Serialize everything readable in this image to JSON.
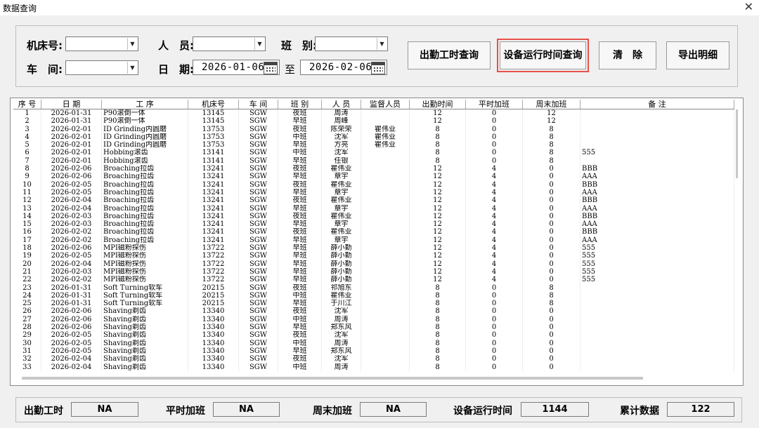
{
  "window": {
    "title": "数据查询",
    "close": "✕"
  },
  "filters": {
    "machine_label": "机床号:",
    "staff_label": "人　员:",
    "shift_label": "班　别:",
    "workshop_label": "车　间:",
    "date_label": "日　期:",
    "to_label": "至",
    "date_from": "2026-01-06",
    "date_to": "2026-02-06"
  },
  "buttons": {
    "attendance_query": "出勤工时查询",
    "runtime_query": "设备运行时间查询",
    "clear": "清　除",
    "export": "导出明细"
  },
  "table": {
    "columns": [
      "序 号",
      "日 期",
      "工 序",
      "机床号",
      "车 间",
      "班 别",
      "人 员",
      "监督人员",
      "出勤时间",
      "平时加班",
      "周末加班",
      "备 注"
    ],
    "rows": [
      [
        "1",
        "2026-01-31",
        "P90滚倒一体",
        "13145",
        "SGW",
        "夜班",
        "周涛",
        "",
        "12",
        "0",
        "12",
        ""
      ],
      [
        "2",
        "2026-01-31",
        "P90滚倒一体",
        "13145",
        "SGW",
        "早班",
        "周峰",
        "",
        "12",
        "0",
        "12",
        ""
      ],
      [
        "3",
        "2026-02-01",
        "ID Grinding内圆磨",
        "13753",
        "SGW",
        "夜班",
        "陈荣荣",
        "瞿伟业",
        "8",
        "0",
        "8",
        ""
      ],
      [
        "4",
        "2026-02-01",
        "ID Grinding内圆磨",
        "13753",
        "SGW",
        "中班",
        "沈军",
        "瞿伟业",
        "8",
        "0",
        "8",
        ""
      ],
      [
        "5",
        "2026-02-01",
        "ID Grinding内圆磨",
        "13753",
        "SGW",
        "早班",
        "方亮",
        "瞿伟业",
        "8",
        "0",
        "8",
        ""
      ],
      [
        "6",
        "2026-02-01",
        "Hobbing滚齿",
        "13141",
        "SGW",
        "中班",
        "沈军",
        "",
        "8",
        "0",
        "8",
        "555"
      ],
      [
        "7",
        "2026-02-01",
        "Hobbing滚齿",
        "13141",
        "SGW",
        "早班",
        "任银",
        "",
        "8",
        "0",
        "8",
        ""
      ],
      [
        "8",
        "2026-02-06",
        "Broaching拉齿",
        "13241",
        "SGW",
        "夜班",
        "瞿伟业",
        "",
        "12",
        "4",
        "0",
        "BBB"
      ],
      [
        "9",
        "2026-02-06",
        "Broaching拉齿",
        "13241",
        "SGW",
        "早班",
        "章宇",
        "",
        "12",
        "4",
        "0",
        "AAA"
      ],
      [
        "10",
        "2026-02-05",
        "Broaching拉齿",
        "13241",
        "SGW",
        "夜班",
        "瞿伟业",
        "",
        "12",
        "4",
        "0",
        "BBB"
      ],
      [
        "11",
        "2026-02-05",
        "Broaching拉齿",
        "13241",
        "SGW",
        "早班",
        "章宇",
        "",
        "12",
        "4",
        "0",
        "AAA"
      ],
      [
        "12",
        "2026-02-04",
        "Broaching拉齿",
        "13241",
        "SGW",
        "夜班",
        "瞿伟业",
        "",
        "12",
        "4",
        "0",
        "BBB"
      ],
      [
        "13",
        "2026-02-04",
        "Broaching拉齿",
        "13241",
        "SGW",
        "早班",
        "章宇",
        "",
        "12",
        "4",
        "0",
        "AAA"
      ],
      [
        "14",
        "2026-02-03",
        "Broaching拉齿",
        "13241",
        "SGW",
        "夜班",
        "瞿伟业",
        "",
        "12",
        "4",
        "0",
        "BBB"
      ],
      [
        "15",
        "2026-02-03",
        "Broaching拉齿",
        "13241",
        "SGW",
        "早班",
        "章宇",
        "",
        "12",
        "4",
        "0",
        "AAA"
      ],
      [
        "16",
        "2026-02-02",
        "Broaching拉齿",
        "13241",
        "SGW",
        "夜班",
        "瞿伟业",
        "",
        "12",
        "4",
        "0",
        "BBB"
      ],
      [
        "17",
        "2026-02-02",
        "Broaching拉齿",
        "13241",
        "SGW",
        "早班",
        "章宇",
        "",
        "12",
        "4",
        "0",
        "AAA"
      ],
      [
        "18",
        "2026-02-06",
        "MPI磁粉探伤",
        "13722",
        "SGW",
        "早班",
        "薛小勤",
        "",
        "12",
        "4",
        "0",
        "555"
      ],
      [
        "19",
        "2026-02-05",
        "MPI磁粉探伤",
        "13722",
        "SGW",
        "早班",
        "薛小勤",
        "",
        "12",
        "4",
        "0",
        "555"
      ],
      [
        "20",
        "2026-02-04",
        "MPI磁粉探伤",
        "13722",
        "SGW",
        "早班",
        "薛小勤",
        "",
        "12",
        "4",
        "0",
        "555"
      ],
      [
        "21",
        "2026-02-03",
        "MPI磁粉探伤",
        "13722",
        "SGW",
        "早班",
        "薛小勤",
        "",
        "12",
        "4",
        "0",
        "555"
      ],
      [
        "22",
        "2026-02-02",
        "MPI磁粉探伤",
        "13722",
        "SGW",
        "早班",
        "薛小勤",
        "",
        "12",
        "4",
        "0",
        "555"
      ],
      [
        "23",
        "2026-01-31",
        "Soft Turning软车",
        "20215",
        "SGW",
        "夜班",
        "祁旭东",
        "",
        "8",
        "0",
        "8",
        ""
      ],
      [
        "24",
        "2026-01-31",
        "Soft Turning软车",
        "20215",
        "SGW",
        "中班",
        "瞿伟业",
        "",
        "8",
        "0",
        "8",
        ""
      ],
      [
        "25",
        "2026-01-31",
        "Soft Turning软车",
        "20215",
        "SGW",
        "早班",
        "于川江",
        "",
        "8",
        "0",
        "8",
        ""
      ],
      [
        "26",
        "2026-02-06",
        "Shaving剃齿",
        "13340",
        "SGW",
        "夜班",
        "沈军",
        "",
        "8",
        "0",
        "0",
        ""
      ],
      [
        "27",
        "2026-02-06",
        "Shaving剃齿",
        "13340",
        "SGW",
        "中班",
        "周涛",
        "",
        "8",
        "0",
        "0",
        ""
      ],
      [
        "28",
        "2026-02-06",
        "Shaving剃齿",
        "13340",
        "SGW",
        "早班",
        "郑东风",
        "",
        "8",
        "0",
        "0",
        ""
      ],
      [
        "29",
        "2026-02-05",
        "Shaving剃齿",
        "13340",
        "SGW",
        "夜班",
        "沈军",
        "",
        "8",
        "0",
        "0",
        ""
      ],
      [
        "30",
        "2026-02-05",
        "Shaving剃齿",
        "13340",
        "SGW",
        "中班",
        "周涛",
        "",
        "8",
        "0",
        "0",
        ""
      ],
      [
        "31",
        "2026-02-05",
        "Shaving剃齿",
        "13340",
        "SGW",
        "早班",
        "郑东风",
        "",
        "8",
        "0",
        "0",
        ""
      ],
      [
        "32",
        "2026-02-04",
        "Shaving剃齿",
        "13340",
        "SGW",
        "夜班",
        "沈军",
        "",
        "8",
        "0",
        "0",
        ""
      ],
      [
        "33",
        "2026-02-04",
        "Shaving剃齿",
        "13340",
        "SGW",
        "中班",
        "周涛",
        "",
        "8",
        "0",
        "0",
        ""
      ]
    ]
  },
  "summary": {
    "attendance_label": "出勤工时",
    "attendance_value": "NA",
    "weekday_ot_label": "平时加班",
    "weekday_ot_value": "NA",
    "weekend_ot_label": "周末加班",
    "weekend_ot_value": "NA",
    "runtime_label": "设备运行时间",
    "runtime_value": "1144",
    "total_label": "累计数据",
    "total_value": "122"
  }
}
